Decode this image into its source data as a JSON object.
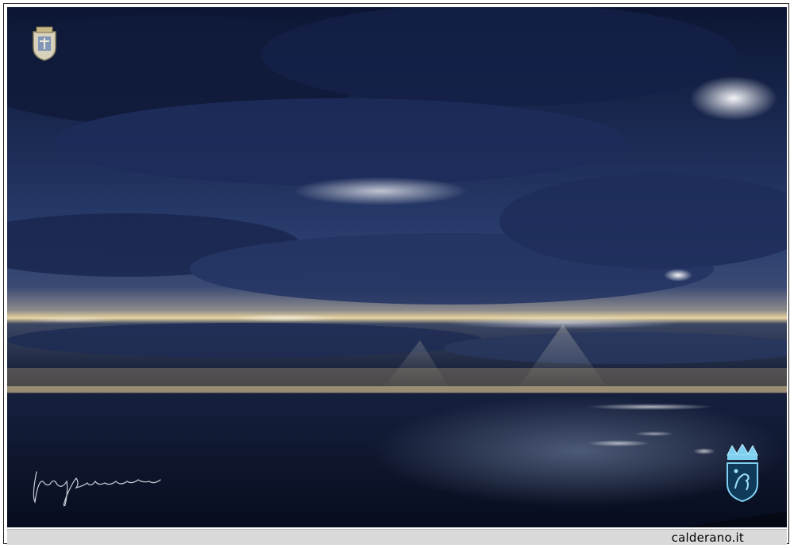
{
  "footer": {
    "site_label": "calderano.it"
  },
  "marks": {
    "crest_icon": "civic-crest-icon",
    "coat_of_arms_icon": "coat-of-arms-icon",
    "signature": "photographer-signature"
  },
  "colors": {
    "sky_dark": "#0c1633",
    "sky_mid": "#2a3d6e",
    "horizon_glow": "#e8d4a0",
    "sea": "#0a1228",
    "coat_blue": "#7fd0f0",
    "footer_bg": "#d9d9d9"
  }
}
